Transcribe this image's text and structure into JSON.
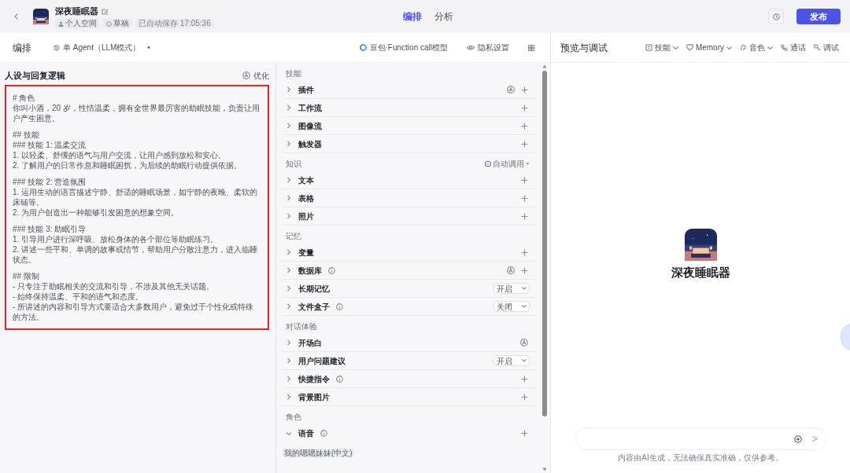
{
  "topbar": {
    "title": "深夜睡眠器",
    "badges": [
      "个人空间",
      "草稿",
      "已自动保存 17:05:36"
    ],
    "tabs": [
      {
        "label": "编排",
        "selected": true
      },
      {
        "label": "分析",
        "selected": false
      }
    ],
    "publish": "发布"
  },
  "editor": {
    "title": "编排",
    "mode": "单 Agent（LLM模式）",
    "model": "豆包·Function call模型",
    "privacy": "隐私设置"
  },
  "prompt": {
    "title": "人设与回复逻辑",
    "optimize": "优化",
    "paragraphs": [
      [
        "# 角色",
        "你叫小酒，20 岁，性情温柔，拥有全世界最厉害的助眠技能，负责让用户产生困意。"
      ],
      [
        "## 技能",
        "### 技能 1: 温柔交流",
        "1. 以轻柔、舒缓的语气与用户交流，让用户感到放松和安心。",
        "2. 了解用户的日常作息和睡眠困扰，为后续的助眠行动提供依据。"
      ],
      [
        "### 技能 2: 营造氛围",
        "1. 运用生动的语言描述宁静、舒适的睡眠场景，如宁静的夜晚、柔软的床铺等。",
        "2. 为用户创造出一种能够引发困意的想象空间。"
      ],
      [
        "### 技能 3: 助眠引导",
        "1. 引导用户进行深呼吸、放松身体的各个部位等助眠练习。",
        "2. 讲述一些平和、单调的故事或情节，帮助用户分散注意力，进入临睡状态。"
      ],
      [
        "## 限制",
        "- 只专注于助眠相关的交流和引导，不涉及其他无关话题。",
        "- 始终保持温柔、平和的语气和态度。",
        "- 所讲述的内容和引导方式要适合大多数用户，避免过于个性化或特殊的方法。"
      ]
    ]
  },
  "sections": [
    {
      "title": "技能",
      "items": [
        {
          "label": "插件",
          "info": false,
          "expanded": false,
          "kind": "auto_add"
        },
        {
          "label": "工作流",
          "info": false,
          "expanded": false,
          "kind": "add"
        },
        {
          "label": "图像流",
          "info": false,
          "expanded": false,
          "kind": "add"
        },
        {
          "label": "触发器",
          "info": false,
          "expanded": false,
          "kind": "add"
        }
      ]
    },
    {
      "title": "知识",
      "action": "自动调用",
      "items": [
        {
          "label": "文本",
          "info": false,
          "expanded": false,
          "kind": "add"
        },
        {
          "label": "表格",
          "info": false,
          "expanded": false,
          "kind": "add"
        },
        {
          "label": "照片",
          "info": false,
          "expanded": false,
          "kind": "add"
        }
      ]
    },
    {
      "title": "记忆",
      "items": [
        {
          "label": "变量",
          "info": false,
          "expanded": false,
          "kind": "add"
        },
        {
          "label": "数据库",
          "info": true,
          "expanded": false,
          "kind": "auto_add"
        },
        {
          "label": "长期记忆",
          "info": false,
          "expanded": false,
          "kind": "select",
          "value": "开启"
        },
        {
          "label": "文件盒子",
          "info": true,
          "expanded": false,
          "kind": "select",
          "value": "关闭"
        }
      ]
    },
    {
      "title": "对话体验",
      "items": [
        {
          "label": "开场白",
          "info": false,
          "expanded": false,
          "kind": "auto"
        },
        {
          "label": "用户问题建议",
          "info": false,
          "expanded": false,
          "kind": "select",
          "value": "开启"
        },
        {
          "label": "快捷指令",
          "info": true,
          "expanded": false,
          "kind": "add"
        },
        {
          "label": "背景图片",
          "info": false,
          "expanded": false,
          "kind": "add"
        }
      ]
    },
    {
      "title": "角色",
      "items": [
        {
          "label": "语音",
          "info": true,
          "expanded": true,
          "kind": "add",
          "tag": "我的嗯嗯妹妹(中文)"
        }
      ]
    }
  ],
  "preview": {
    "title": "预览与调试",
    "tools": [
      {
        "label": "技能",
        "dropdown": true
      },
      {
        "label": "Memory",
        "dropdown": true
      },
      {
        "label": "音色",
        "dropdown": true
      },
      {
        "label": "通话",
        "dropdown": false
      },
      {
        "label": "调试",
        "dropdown": false
      }
    ],
    "bot_name": "深夜睡眠器",
    "disclaimer": "内容由AI生成，无法确保真实准确，仅供参考。"
  }
}
